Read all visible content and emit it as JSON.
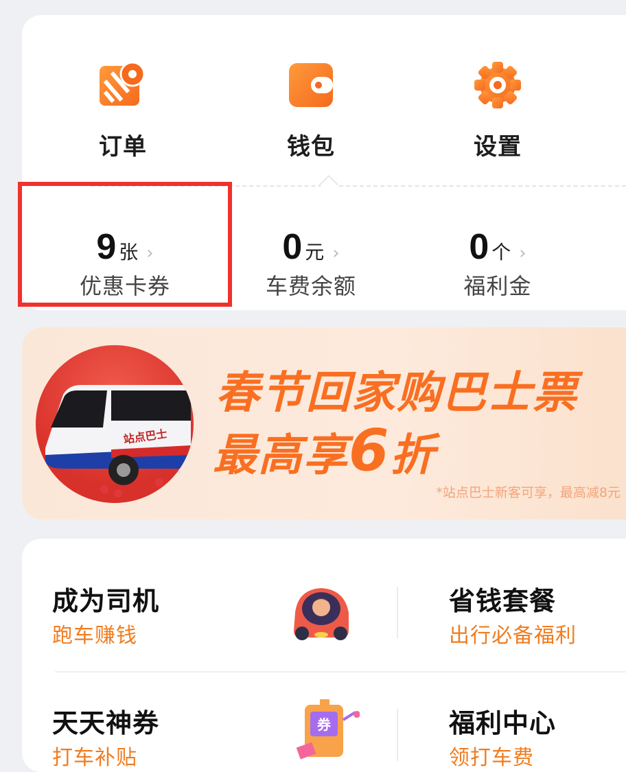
{
  "quick_actions": [
    {
      "label": "订单",
      "icon": "order-map-icon"
    },
    {
      "label": "钱包",
      "icon": "wallet-icon"
    },
    {
      "label": "设置",
      "icon": "gear-icon"
    }
  ],
  "stats": [
    {
      "value": "9",
      "unit": "张",
      "label": "优惠卡券"
    },
    {
      "value": "0",
      "unit": "元",
      "label": "车费余额"
    },
    {
      "value": "0",
      "unit": "个",
      "label": "福利金"
    }
  ],
  "banner": {
    "line1": "春节回家购巴士票",
    "line2_prefix": "最高享",
    "line2_number": "6",
    "line2_suffix": "折",
    "note": "*站点巴士新客可享，最高减8元",
    "bus_text": "站点巴士"
  },
  "services": [
    {
      "title": "成为司机",
      "subtitle": "跑车赚钱"
    },
    {
      "title": "省钱套餐",
      "subtitle": "出行必备福利"
    },
    {
      "title": "天天神券",
      "subtitle": "打车补贴"
    },
    {
      "title": "福利中心",
      "subtitle": "领打车费"
    }
  ],
  "coupon_icon_text": "券",
  "colors": {
    "accent": "#f96f22",
    "highlight": "#f0312c",
    "subtitle": "#f17c1e"
  }
}
